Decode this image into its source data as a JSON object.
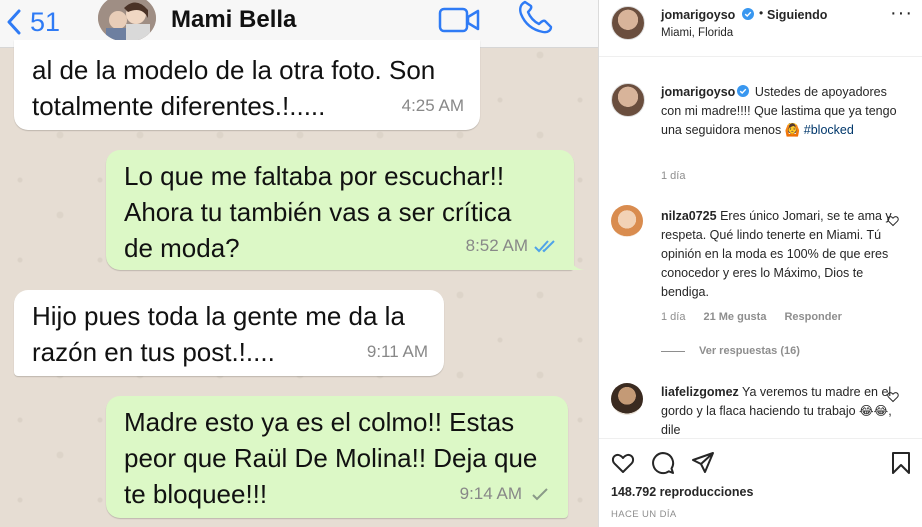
{
  "whatsapp": {
    "back_count": "51",
    "contact_name": "Mami Bella",
    "icons": {
      "back": "chevron-left-icon",
      "video": "video-call-icon",
      "call": "phone-icon"
    },
    "accent": "#2f7bf5",
    "messages": [
      {
        "direction": "in",
        "text": "al de la modelo de la otra foto. Son\ntotalmente diferentes.!.....",
        "time": "4:25 AM",
        "status": ""
      },
      {
        "direction": "out",
        "text": "Lo que me faltaba por escuchar!!\nAhora tu también vas a ser crítica\nde moda?",
        "time": "8:52 AM",
        "status": "read"
      },
      {
        "direction": "in",
        "text": "Hijo pues toda la gente me da la\nrazón en tus post.!....",
        "time": "9:11 AM",
        "status": ""
      },
      {
        "direction": "out",
        "text": "Madre esto ya es el colmo!! Estas\npeor que Raül De Molina!! Deja que\nte bloquee!!!",
        "time": "9:14 AM",
        "status": "delivered"
      }
    ]
  },
  "instagram": {
    "header": {
      "username": "jomarigoyso",
      "separator": "•",
      "follow_state": "Siguiendo",
      "location": "Miami, Florida",
      "more_icon": "more-options-icon"
    },
    "caption": {
      "username": "jomarigoyso",
      "text": "Ustedes de apoyadores con mi madre!!!! Que lastima que ya tengo una seguidora menos",
      "emoji": "🙆",
      "hashtag": "#blocked",
      "time": "1 día"
    },
    "comments": [
      {
        "username": "nilza0725",
        "text": "Eres único Jomari, se te ama y respeta. Qué lindo tenerte en Miami. Tú opinión en la moda es 100% de que eres conocedor y eres lo Máximo, Dios te bendiga.",
        "time": "1 día",
        "likes": "21 Me gusta",
        "reply": "Responder",
        "view_replies": "Ver respuestas (16)"
      },
      {
        "username": "liafelizgomez",
        "text": "Ya veremos tu madre en el gordo y la flaca haciendo tu trabajo 😂😂, dile"
      }
    ],
    "views": "148.792 reproducciones",
    "posted": "HACE UN DÍA",
    "colors": {
      "verified": "#3897f0",
      "hashtag": "#00376b",
      "muted": "#8e8e8e"
    }
  }
}
